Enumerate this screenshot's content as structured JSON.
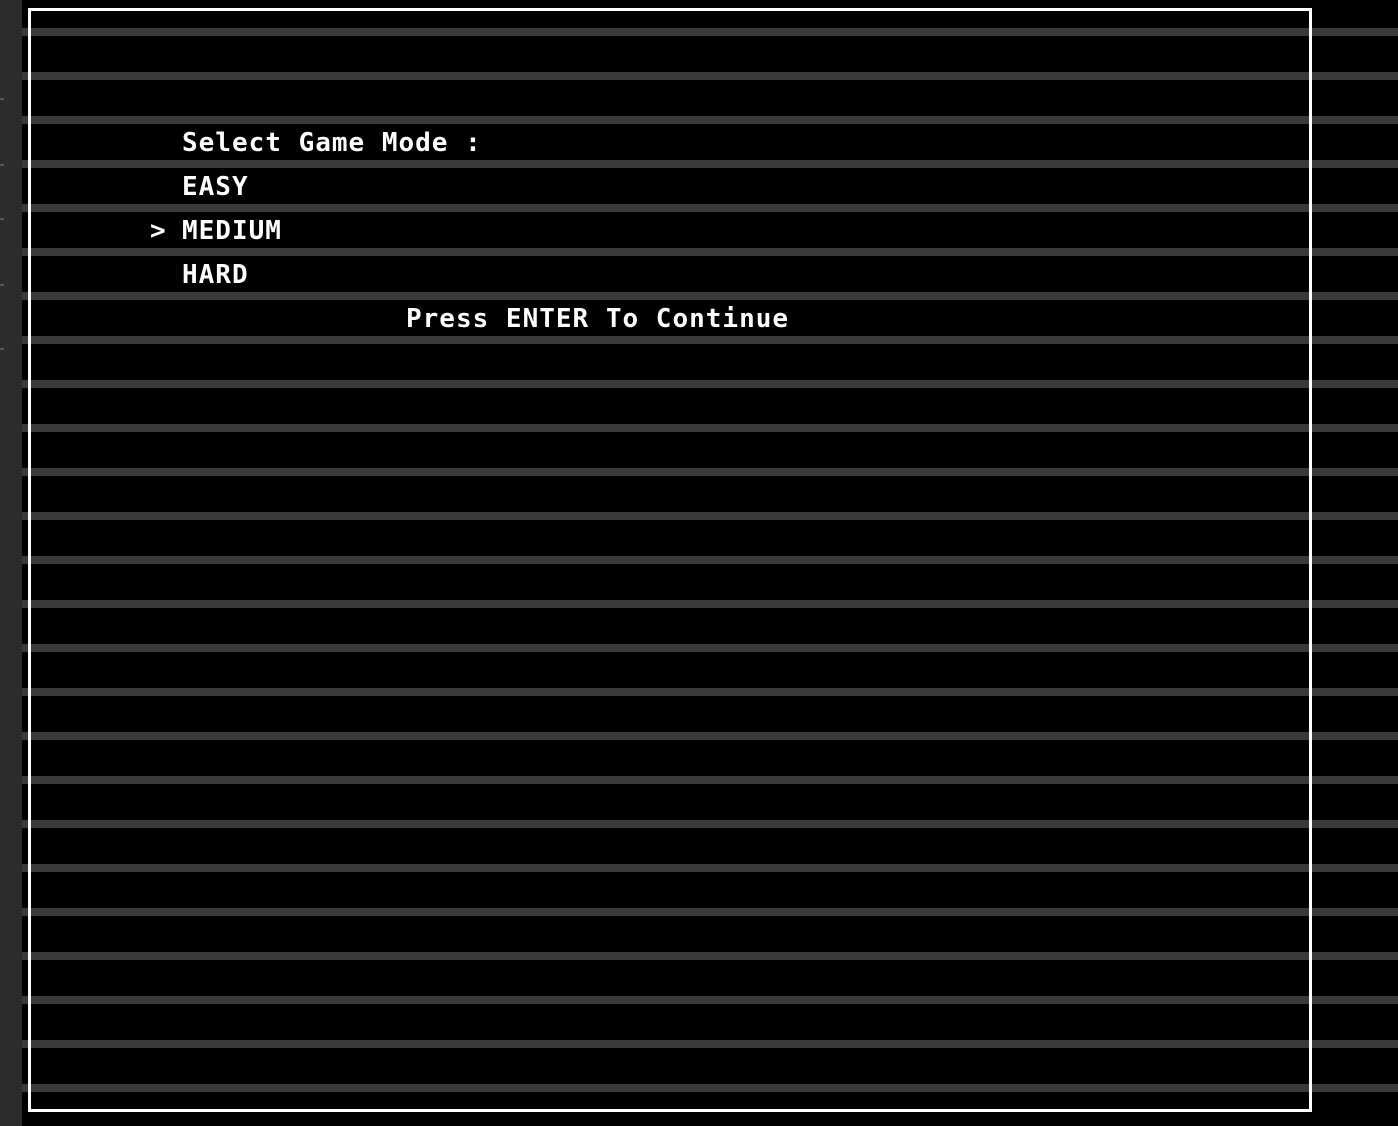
{
  "menu": {
    "prompt": "Select Game Mode :",
    "cursor": ">",
    "options": [
      "EASY",
      "MEDIUM",
      "HARD"
    ],
    "selected": "MEDIUM",
    "footer": "Press ENTER To Continue"
  },
  "colors": {
    "background": "#000000",
    "text": "#ffffff",
    "scanline": "#3a3a3a",
    "frame": "#ffffff"
  }
}
